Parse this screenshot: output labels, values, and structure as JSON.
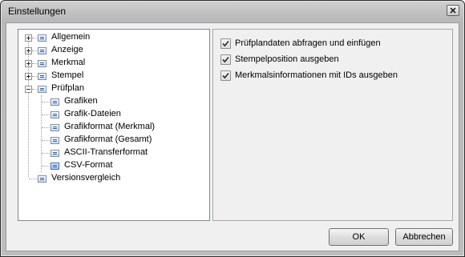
{
  "window": {
    "title": "Einstellungen",
    "close_icon": "close-icon"
  },
  "tree": {
    "items": [
      {
        "label": "Allgemein",
        "expander": "plus"
      },
      {
        "label": "Anzeige",
        "expander": "plus"
      },
      {
        "label": "Merkmal",
        "expander": "plus"
      },
      {
        "label": "Stempel",
        "expander": "plus"
      },
      {
        "label": "Prüfplan",
        "expander": "minus"
      },
      {
        "label": "Grafiken"
      },
      {
        "label": "Grafik-Dateien"
      },
      {
        "label": "Grafikformat (Merkmal)"
      },
      {
        "label": "Grafikformat (Gesamt)"
      },
      {
        "label": "ASCII-Transferformat"
      },
      {
        "label": "CSV-Format",
        "selected": true
      },
      {
        "label": "Versionsvergleich"
      }
    ]
  },
  "options": [
    {
      "label": "Prüfplandaten abfragen und einfügen",
      "checked": true
    },
    {
      "label": "Stempelposition ausgeben",
      "checked": true
    },
    {
      "label": "Merkmalsinformationen mit IDs ausgeben",
      "checked": true
    }
  ],
  "buttons": {
    "ok": "OK",
    "cancel": "Abbrechen"
  }
}
